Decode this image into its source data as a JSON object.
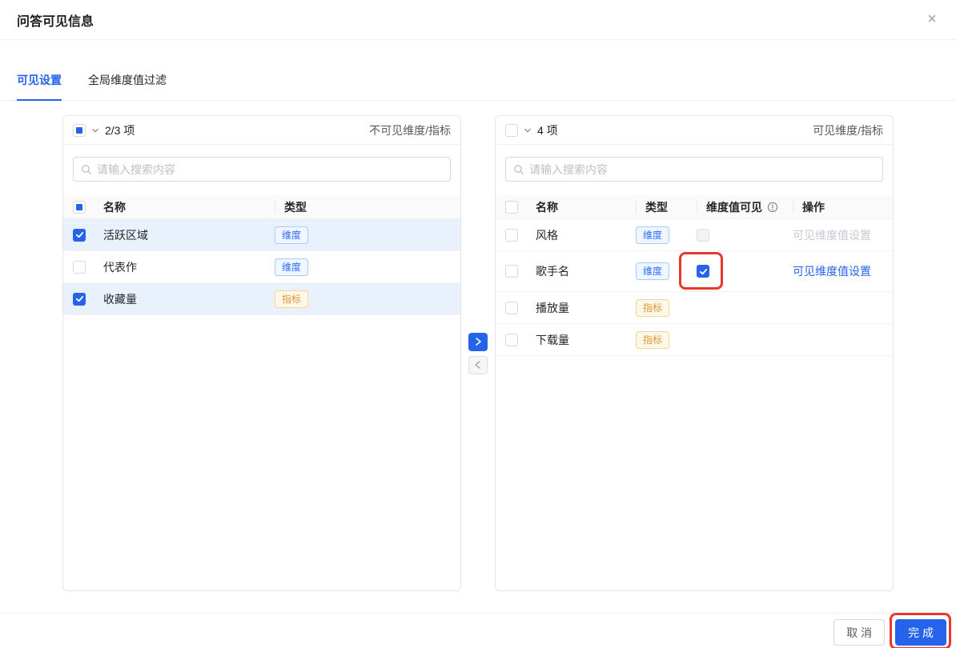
{
  "dialog": {
    "title": "问答可见信息",
    "close_icon": "×"
  },
  "tabs": [
    {
      "label": "可见设置",
      "active": true
    },
    {
      "label": "全局维度值过滤",
      "active": false
    }
  ],
  "transfer": {
    "left": {
      "count_label": "2/3 项",
      "panel_label": "不可见维度/指标",
      "search_placeholder": "请输入搜索内容",
      "search_value": "",
      "header_checkbox_state": "indeterminate",
      "columns": [
        "名称",
        "类型"
      ],
      "rows": [
        {
          "name": "活跃区域",
          "type": "维度",
          "type_kind": "dimension",
          "checked": true,
          "selected": true
        },
        {
          "name": "代表作",
          "type": "维度",
          "type_kind": "dimension",
          "checked": false,
          "selected": false
        },
        {
          "name": "收藏量",
          "type": "指标",
          "type_kind": "metric",
          "checked": true,
          "selected": true
        }
      ]
    },
    "right": {
      "count_label": "4 项",
      "panel_label": "可见维度/指标",
      "search_placeholder": "请输入搜索内容",
      "search_value": "",
      "header_checkbox_state": "unchecked",
      "columns": [
        "名称",
        "类型",
        "维度值可见",
        "操作"
      ],
      "rows": [
        {
          "name": "风格",
          "type": "维度",
          "type_kind": "dimension",
          "checked": false,
          "dim_value_visible": false,
          "action": "可见维度值设置",
          "action_state": "disabled"
        },
        {
          "name": "歌手名",
          "type": "维度",
          "type_kind": "dimension",
          "checked": false,
          "dim_value_visible": true,
          "action": "可见维度值设置",
          "action_state": "enabled",
          "annotated": true
        },
        {
          "name": "播放量",
          "type": "指标",
          "type_kind": "metric",
          "checked": false
        },
        {
          "name": "下载量",
          "type": "指标",
          "type_kind": "metric",
          "checked": false
        }
      ]
    }
  },
  "footer": {
    "cancel_label": "取 消",
    "confirm_label": "完 成",
    "confirm_annotated": true
  },
  "icons": {
    "close": "x-icon",
    "chevron_down": "chevron-down-icon",
    "search": "magnifier-icon",
    "info": "info-circle-icon",
    "move_right": "chevron-right-icon",
    "move_left": "chevron-left-icon"
  },
  "colors": {
    "accent_blue": "#2563eb",
    "annotation_red": "#e8382d",
    "dimension_tag_text": "#2f6bff",
    "dimension_tag_bg": "#f0f6ff",
    "metric_tag_text": "#dd9436",
    "metric_tag_bg": "#fff8e8",
    "selected_row_bg": "#e8f1fc"
  }
}
